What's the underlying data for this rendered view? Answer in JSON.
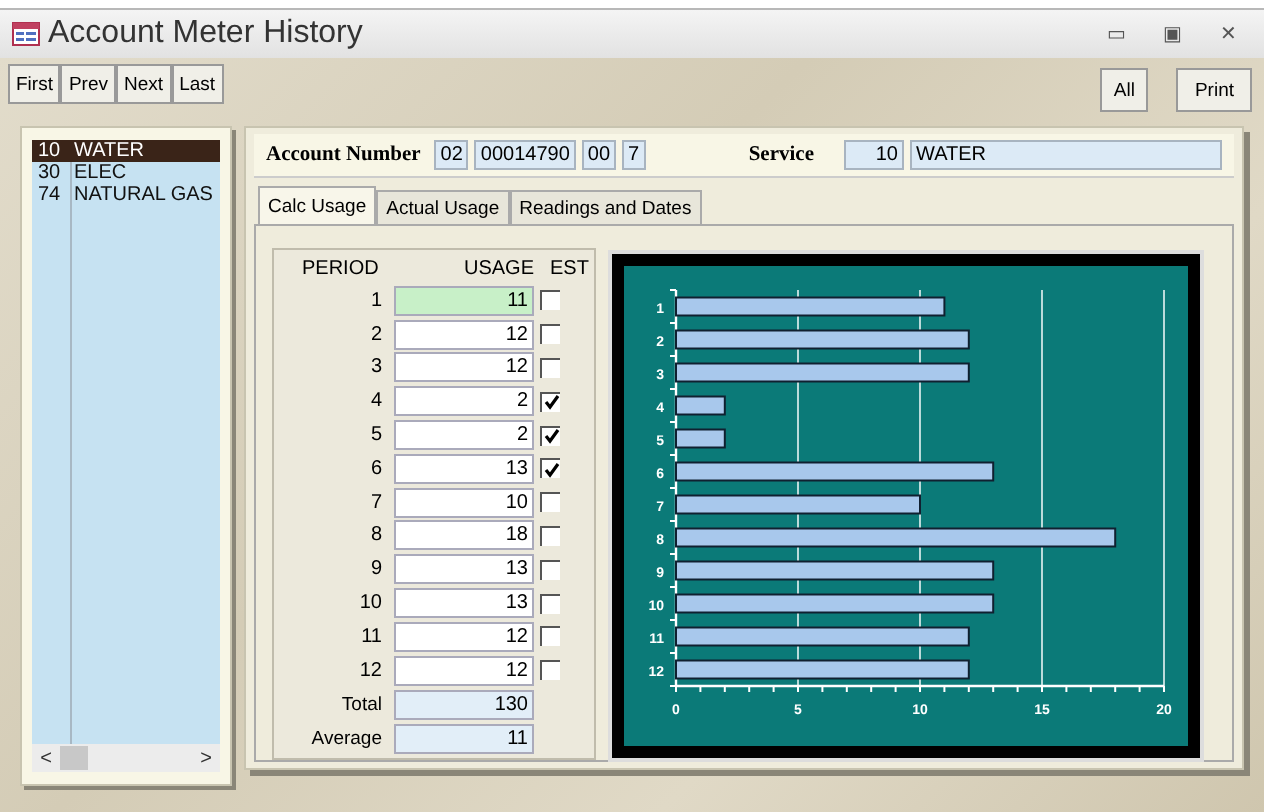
{
  "window": {
    "title": "Account Meter History",
    "controls": [
      "▭",
      "▣",
      "✕"
    ]
  },
  "nav_buttons": [
    "First",
    "Prev",
    "Next",
    "Last"
  ],
  "right_buttons": [
    "All",
    "Print"
  ],
  "services": [
    {
      "code": "10",
      "name": "WATER",
      "selected": true
    },
    {
      "code": "30",
      "name": "ELEC",
      "selected": false
    },
    {
      "code": "74",
      "name": "NATURAL GAS",
      "selected": false
    }
  ],
  "scrollbar": {
    "left": "<",
    "right": ">"
  },
  "account": {
    "label": "Account Number",
    "parts": [
      "02",
      "00014790",
      "00",
      "7"
    ],
    "service_label": "Service",
    "service_code": "10",
    "service_name": "WATER"
  },
  "tabs": [
    {
      "label": "Calc Usage",
      "selected": true
    },
    {
      "label": "Actual Usage",
      "selected": false
    },
    {
      "label": "Readings and Dates",
      "selected": false
    }
  ],
  "columns": [
    "PERIOD",
    "USAGE",
    "EST"
  ],
  "rows": [
    {
      "period": "1",
      "usage": "11",
      "est": false,
      "selected": true
    },
    {
      "period": "2",
      "usage": "12",
      "est": false,
      "selected": false
    },
    {
      "period": "3",
      "usage": "12",
      "est": false,
      "selected": false
    },
    {
      "period": "4",
      "usage": "2",
      "est": true,
      "selected": false
    },
    {
      "period": "5",
      "usage": "2",
      "est": true,
      "selected": false
    },
    {
      "period": "6",
      "usage": "13",
      "est": true,
      "selected": false
    },
    {
      "period": "7",
      "usage": "10",
      "est": false,
      "selected": false
    },
    {
      "period": "8",
      "usage": "18",
      "est": false,
      "selected": false
    },
    {
      "period": "9",
      "usage": "13",
      "est": false,
      "selected": false
    },
    {
      "period": "10",
      "usage": "13",
      "est": false,
      "selected": false
    },
    {
      "period": "11",
      "usage": "12",
      "est": false,
      "selected": false
    },
    {
      "period": "12",
      "usage": "12",
      "est": false,
      "selected": false
    }
  ],
  "totals": [
    {
      "label": "Total",
      "value": "130"
    },
    {
      "label": "Average",
      "value": "11"
    }
  ],
  "chart_data": {
    "type": "bar",
    "orientation": "horizontal",
    "categories": [
      "1",
      "2",
      "3",
      "4",
      "5",
      "6",
      "7",
      "8",
      "9",
      "10",
      "11",
      "12"
    ],
    "series": [
      {
        "color": "#a8c8ec",
        "values": [
          11,
          12,
          12,
          2,
          2,
          13,
          10,
          18,
          13,
          13,
          12,
          12
        ]
      }
    ],
    "xlim": [
      0,
      20
    ],
    "xticks": [
      0,
      5,
      10,
      15,
      20
    ],
    "grid": true
  }
}
